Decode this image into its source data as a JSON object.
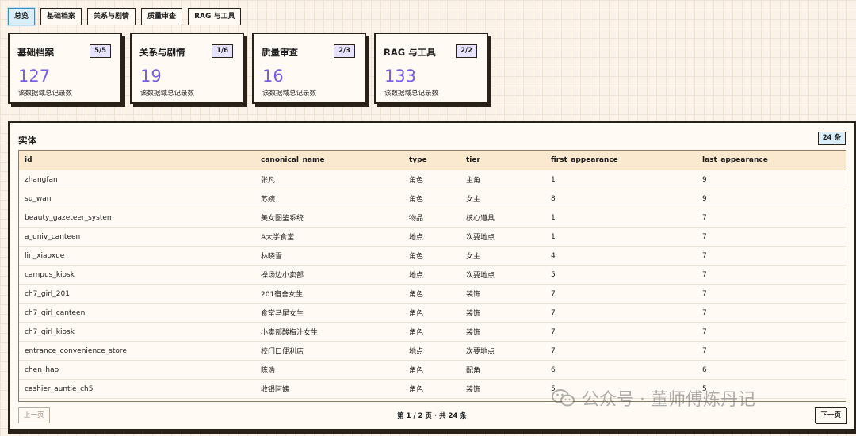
{
  "nav": {
    "tabs": [
      {
        "label": "总览",
        "active": true
      },
      {
        "label": "基础档案",
        "active": false
      },
      {
        "label": "关系与剧情",
        "active": false
      },
      {
        "label": "质量审查",
        "active": false
      },
      {
        "label": "RAG 与工具",
        "active": false
      }
    ]
  },
  "cards": [
    {
      "title": "基础档案",
      "badge": "5/5",
      "count": "127",
      "desc": "该数据域总记录数"
    },
    {
      "title": "关系与剧情",
      "badge": "1/6",
      "count": "19",
      "desc": "该数据域总记录数"
    },
    {
      "title": "质量审查",
      "badge": "2/3",
      "count": "16",
      "desc": "该数据域总记录数"
    },
    {
      "title": "RAG 与工具",
      "badge": "2/2",
      "count": "133",
      "desc": "该数据域总记录数"
    }
  ],
  "panel": {
    "title": "实体",
    "row_badge": "24 条",
    "columns": [
      "id",
      "canonical_name",
      "type",
      "tier",
      "first_appearance",
      "last_appearance"
    ],
    "rows": [
      [
        "zhangfan",
        "张凡",
        "角色",
        "主角",
        "1",
        "9"
      ],
      [
        "su_wan",
        "苏婉",
        "角色",
        "女主",
        "8",
        "9"
      ],
      [
        "beauty_gazeteer_system",
        "美女图鉴系统",
        "物品",
        "核心道具",
        "1",
        "7"
      ],
      [
        "a_univ_canteen",
        "A大学食堂",
        "地点",
        "次要地点",
        "1",
        "7"
      ],
      [
        "lin_xiaoxue",
        "林晓雪",
        "角色",
        "女主",
        "4",
        "7"
      ],
      [
        "campus_kiosk",
        "操场边小卖部",
        "地点",
        "次要地点",
        "5",
        "7"
      ],
      [
        "ch7_girl_201",
        "201宿舍女生",
        "角色",
        "装饰",
        "7",
        "7"
      ],
      [
        "ch7_girl_canteen",
        "食堂马尾女生",
        "角色",
        "装饰",
        "7",
        "7"
      ],
      [
        "ch7_girl_kiosk",
        "小卖部酸梅汁女生",
        "角色",
        "装饰",
        "7",
        "7"
      ],
      [
        "entrance_convenience_store",
        "校门口便利店",
        "地点",
        "次要地点",
        "7",
        "7"
      ],
      [
        "chen_hao",
        "陈浩",
        "角色",
        "配角",
        "6",
        "6"
      ],
      [
        "cashier_auntie_ch5",
        "收银阿姨",
        "角色",
        "装饰",
        "5",
        "5"
      ]
    ]
  },
  "pager": {
    "prev_label": "上一页",
    "info": "第 1 / 2 页 · 共 24 条",
    "next_label": "下一页"
  },
  "watermark": {
    "text": "公众号 · 董师傅炼丹记"
  }
}
